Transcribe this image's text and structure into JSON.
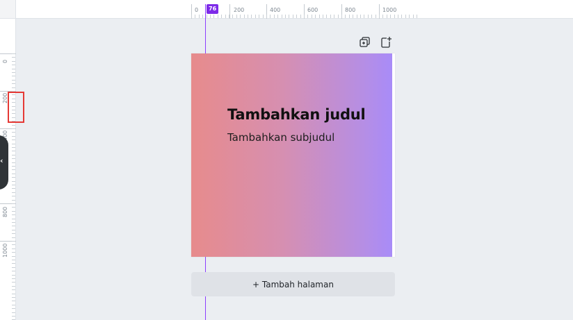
{
  "ruler": {
    "top_labels": [
      "0",
      "200",
      "400",
      "600",
      "800",
      "1000"
    ],
    "left_labels": [
      "0",
      "200",
      "400",
      "800",
      "1000"
    ],
    "position_marker": "76"
  },
  "toolbar": {
    "duplicate_icon": "duplicate-page-icon",
    "add_icon": "add-page-icon"
  },
  "page": {
    "title": "Tambahkan judul",
    "subtitle": "Tambahkan subjudul",
    "gradient_start": "#e78b8c",
    "gradient_end": "#a78bfa"
  },
  "add_page_button": {
    "label": "+ Tambah halaman"
  },
  "colors": {
    "accent": "#7d2ae8",
    "highlight": "#e53935",
    "canvas": "#ebeef2"
  }
}
